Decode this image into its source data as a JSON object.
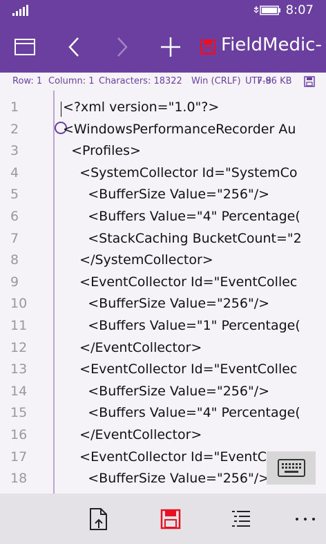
{
  "status": {
    "time": "8:07"
  },
  "app": {
    "title": "FieldMedic-"
  },
  "info": {
    "row": "Row: 1",
    "column": "Column: 1",
    "characters": "Characters: 18322",
    "line_ending": "Win (CRLF)",
    "encoding": "UTF-8",
    "size": "7.96 KB"
  },
  "editor": {
    "lines": [
      {
        "num": "1",
        "text": "<?xml version=\"1.0\"?>"
      },
      {
        "num": "2",
        "text": "<WindowsPerformanceRecorder Au"
      },
      {
        "num": "3",
        "text": "  <Profiles>"
      },
      {
        "num": "4",
        "text": "    <SystemCollector Id=\"SystemCo"
      },
      {
        "num": "5",
        "text": "      <BufferSize Value=\"256\"/>"
      },
      {
        "num": "6",
        "text": "      <Buffers Value=\"4\" Percentage("
      },
      {
        "num": "7",
        "text": "      <StackCaching BucketCount=\"2"
      },
      {
        "num": "8",
        "text": "    </SystemCollector>"
      },
      {
        "num": "9",
        "text": "    <EventCollector Id=\"EventCollec"
      },
      {
        "num": "10",
        "text": "      <BufferSize Value=\"256\"/>"
      },
      {
        "num": "11",
        "text": "      <Buffers Value=\"1\" Percentage("
      },
      {
        "num": "12",
        "text": "    </EventCollector>"
      },
      {
        "num": "13",
        "text": "    <EventCollector Id=\"EventCollec"
      },
      {
        "num": "14",
        "text": "      <BufferSize Value=\"256\"/>"
      },
      {
        "num": "15",
        "text": "      <Buffers Value=\"4\" Percentage("
      },
      {
        "num": "16",
        "text": "    </EventCollector>"
      },
      {
        "num": "17",
        "text": "    <EventCollector Id=\"EventCollec"
      },
      {
        "num": "18",
        "text": "      <BufferSize Value=\"256\"/>"
      }
    ]
  },
  "colors": {
    "accent": "#6b3fa0",
    "save": "#e81123"
  }
}
